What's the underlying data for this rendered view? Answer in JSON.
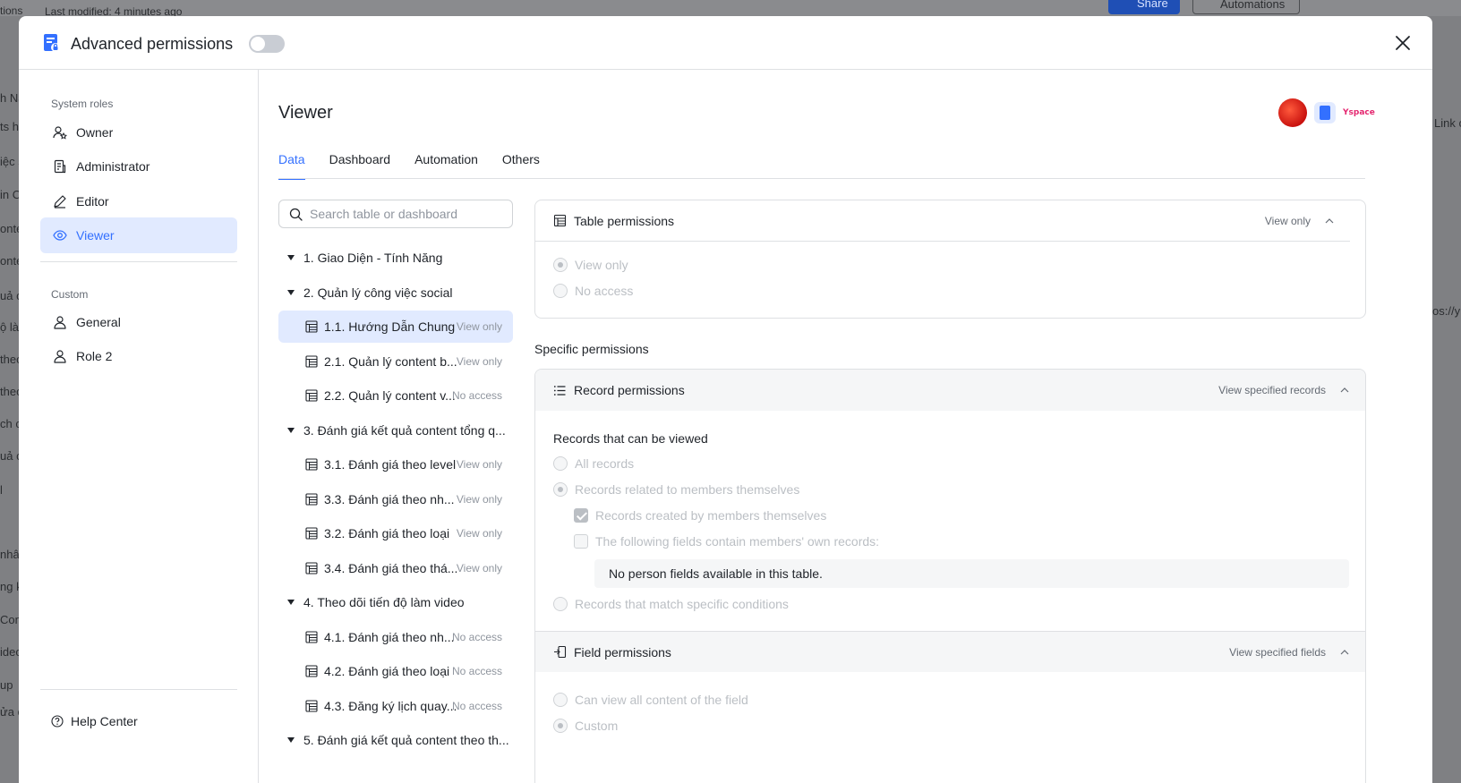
{
  "background": {
    "top_left_text": "tions",
    "last_modified": "Last modified: 4 minutes ago",
    "share_label": "Share",
    "automations_label": "Automations",
    "left_fragments": [
      "h Na",
      "ts h",
      "iệc s",
      "in C",
      "onte",
      "onte",
      "uả c",
      "ộ là",
      "theo",
      "theo",
      "ch c",
      "uả c",
      "l",
      "nhâ",
      "ng k",
      "Cont",
      "ideo",
      "up",
      "ửa c"
    ],
    "right_fragments": [
      "Link c",
      "os://y"
    ]
  },
  "modal": {
    "title": "Advanced permissions",
    "toggle_on": false
  },
  "sidebar": {
    "system_roles_label": "System roles",
    "system_roles": [
      {
        "label": "Owner",
        "icon": "owner-icon"
      },
      {
        "label": "Administrator",
        "icon": "administrator-icon"
      },
      {
        "label": "Editor",
        "icon": "editor-icon"
      },
      {
        "label": "Viewer",
        "icon": "eye-icon",
        "active": true
      }
    ],
    "custom_label": "Custom",
    "custom_roles": [
      {
        "label": "General",
        "icon": "person-icon"
      },
      {
        "label": "Role 2",
        "icon": "person-icon"
      }
    ],
    "help_label": "Help Center"
  },
  "main": {
    "title": "Viewer",
    "tabs": [
      {
        "label": "Data",
        "active": true
      },
      {
        "label": "Dashboard"
      },
      {
        "label": "Automation"
      },
      {
        "label": "Others"
      }
    ],
    "search_placeholder": "Search table or dashboard",
    "tree": [
      {
        "type": "group",
        "label": "1. Giao Diện - Tính Năng"
      },
      {
        "type": "group",
        "label": "2. Quản lý công việc social"
      },
      {
        "type": "child",
        "label": "1.1. Hướng Dẫn Chung",
        "perm": "View only",
        "active": true
      },
      {
        "type": "child",
        "label": "2.1. Quản lý content b...",
        "perm": "View only"
      },
      {
        "type": "child",
        "label": "2.2. Quản lý content v...",
        "perm": "No access"
      },
      {
        "type": "group",
        "label": "3. Đánh giá kết quả content tổng q..."
      },
      {
        "type": "child",
        "label": "3.1. Đánh giá theo level",
        "perm": "View only"
      },
      {
        "type": "child",
        "label": "3.3. Đánh giá theo nh...",
        "perm": "View only"
      },
      {
        "type": "child",
        "label": "3.2. Đánh giá theo loại",
        "perm": "View only"
      },
      {
        "type": "child",
        "label": "3.4. Đánh giá theo thá...",
        "perm": "View only"
      },
      {
        "type": "group",
        "label": "4. Theo dõi tiến độ làm video"
      },
      {
        "type": "child",
        "label": "4.1. Đánh giá theo nh...",
        "perm": "No access"
      },
      {
        "type": "child",
        "label": "4.2. Đánh giá theo loại",
        "perm": "No access"
      },
      {
        "type": "child",
        "label": "4.3. Đăng ký lịch quay...",
        "perm": "No access"
      },
      {
        "type": "group",
        "label": "5. Đánh giá kết quả content theo th..."
      }
    ],
    "table_permissions": {
      "title": "Table permissions",
      "summary": "View only",
      "options": [
        "View only",
        "No access"
      ],
      "selected": "View only"
    },
    "specific_label": "Specific permissions",
    "record_permissions": {
      "title": "Record permissions",
      "summary": "View specified records",
      "viewable_label": "Records that can be viewed",
      "all_records": "All records",
      "related_records": "Records related to members themselves",
      "created_by": "Records created by members themselves",
      "fields_contain": "The following fields contain members' own records:",
      "no_person_fields": "No person fields available in this table.",
      "match_conditions": "Records that match specific conditions"
    },
    "field_permissions": {
      "title": "Field permissions",
      "summary": "View specified fields",
      "view_all": "Can view all content of the field",
      "custom": "Custom"
    }
  }
}
